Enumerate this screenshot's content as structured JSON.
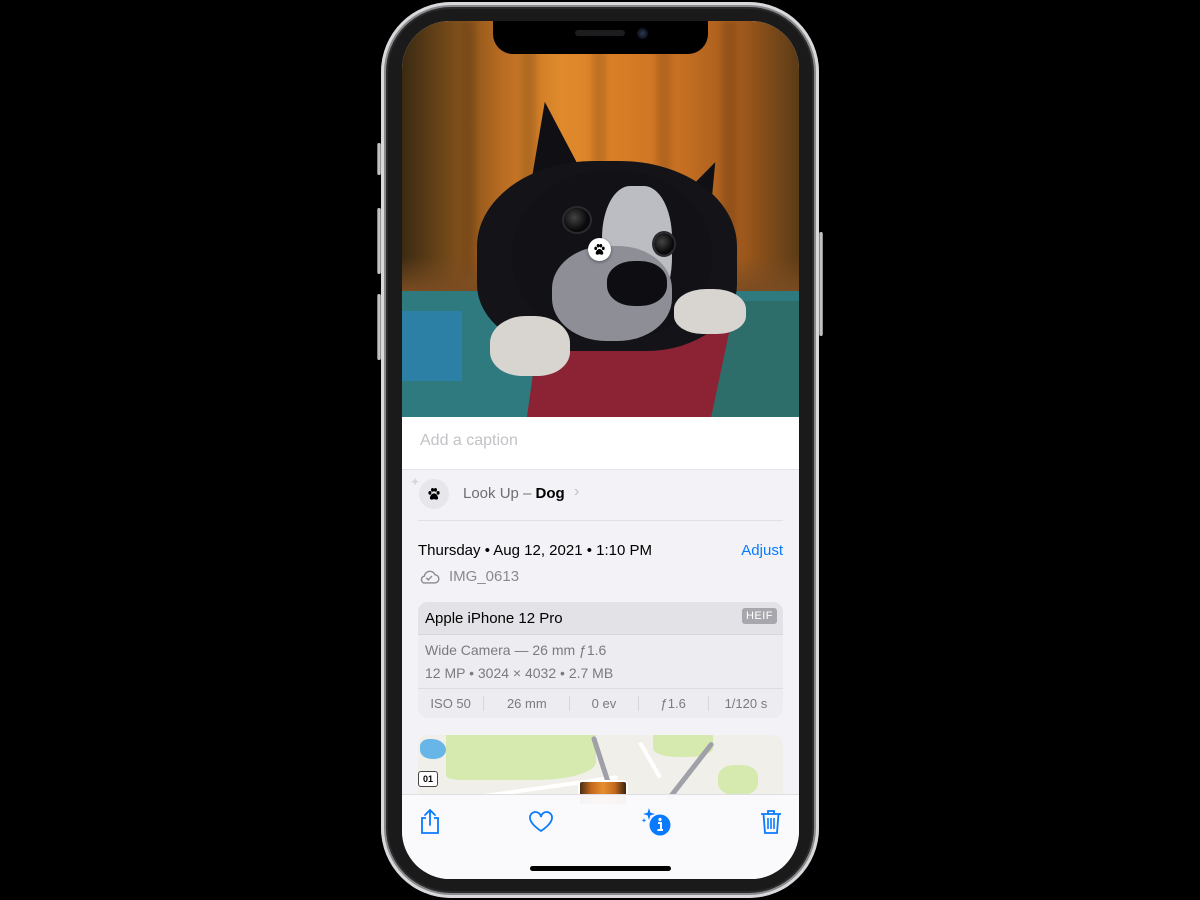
{
  "device": {
    "model_frame": "iPhone",
    "status": "Photos info view"
  },
  "photo": {
    "subject": "Boston Terrier dog lying on a rug",
    "visual_lookup_marker_icon": "paw-icon"
  },
  "caption": {
    "placeholder": "Add a caption",
    "value": ""
  },
  "lookup": {
    "icon": "paw-icon",
    "prefix": "Look Up – ",
    "subject": "Dog",
    "chevron": "›"
  },
  "date": {
    "text": "Thursday • Aug 12, 2021 • 1:10 PM",
    "adjust_label": "Adjust"
  },
  "file": {
    "icon": "cloud-check-icon",
    "name": "IMG_0613"
  },
  "camera_card": {
    "device": "Apple iPhone 12 Pro",
    "format_badge": "HEIF",
    "lens": "Wide Camera — 26 mm ƒ1.6",
    "specs": "12 MP  •  3024 × 4032  •  2.7 MB",
    "exif": [
      {
        "label": "ISO 50"
      },
      {
        "label": "26 mm"
      },
      {
        "label": "0 ev"
      },
      {
        "label": "ƒ1.6"
      },
      {
        "label": "1/120 s"
      }
    ]
  },
  "map": {
    "route_shield": "01"
  },
  "toolbar": {
    "share": "share-icon",
    "favorite": "heart-icon",
    "info": "info-sparkle-icon",
    "delete": "trash-icon"
  },
  "colors": {
    "accent": "#0a7aff",
    "background": "#f2f2f7",
    "secondary_text": "#8a8a8e"
  }
}
